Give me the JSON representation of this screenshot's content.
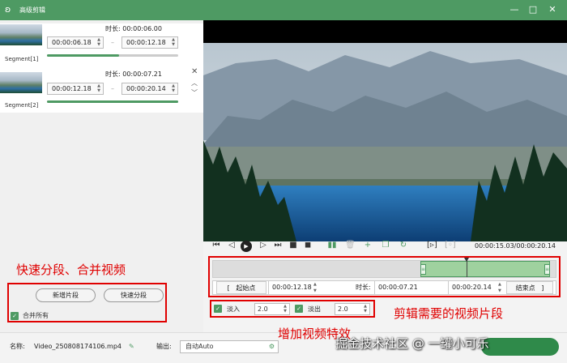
{
  "window": {
    "title": "高级剪辑",
    "logo_icon": "rabbit-logo-icon",
    "minimize": "—",
    "maximize": "□",
    "close": "✕"
  },
  "segments": [
    {
      "label": "Segment[1]",
      "duration_label": "时长:",
      "duration": "00:00:06.00",
      "start": "00:00:06.18",
      "end": "00:00:12.18",
      "progress": 0.55
    },
    {
      "label": "Segment[2]",
      "duration_label": "时长:",
      "duration": "00:00:07.21",
      "start": "00:00:12.18",
      "end": "00:00:20.14",
      "progress": 1.0
    }
  ],
  "segment_close": "✕",
  "segment_move_up": "︿",
  "segment_move_down": "﹀",
  "range_dash": "–",
  "spin_up": "▲",
  "spin_down": "▼",
  "left_actions": {
    "add_segment": "新增片段",
    "quick_split": "快速分段",
    "merge_all_label": "合并所有",
    "merge_all_checked": true
  },
  "player": {
    "time_readout": "00:00:15.03/00:00:20.14",
    "playhead": 0.74
  },
  "playback_icons": [
    "skip-start-icon",
    "step-back-icon",
    "play-icon",
    "step-forward-icon",
    "skip-end-icon",
    "stop-icon",
    "split-icon",
    "delete-icon",
    "add-icon",
    "copy-icon",
    "refresh-icon",
    "bracket-in-icon",
    "bracket-out-icon"
  ],
  "range": {
    "start_btn": "起始点",
    "start_bracket": "[",
    "start_time": "00:00:12.18",
    "duration_label": "时长:",
    "duration": "00:00:07.21",
    "end_time": "00:00:20.14",
    "end_btn": "结束点",
    "end_bracket": "]"
  },
  "effects": {
    "fade_in_label": "淡入",
    "fade_in_value": "2.0",
    "fade_out_label": "淡出",
    "fade_out_value": "2.0",
    "fade_in_checked": true,
    "fade_out_checked": true
  },
  "bottom": {
    "name_label": "名称:",
    "file_name": "Video_250808174106.mp4",
    "output_label": "输出:",
    "output_value": "自动Auto"
  },
  "annotations": {
    "split_merge": "快速分段、合并视频",
    "trim": "剪辑需要的视频片段",
    "effects": "增加视频特效"
  },
  "watermark": "掘金技术社区 @ 一罐小可乐",
  "colors": {
    "accent": "#4e9a63",
    "annotation": "#e00000"
  }
}
